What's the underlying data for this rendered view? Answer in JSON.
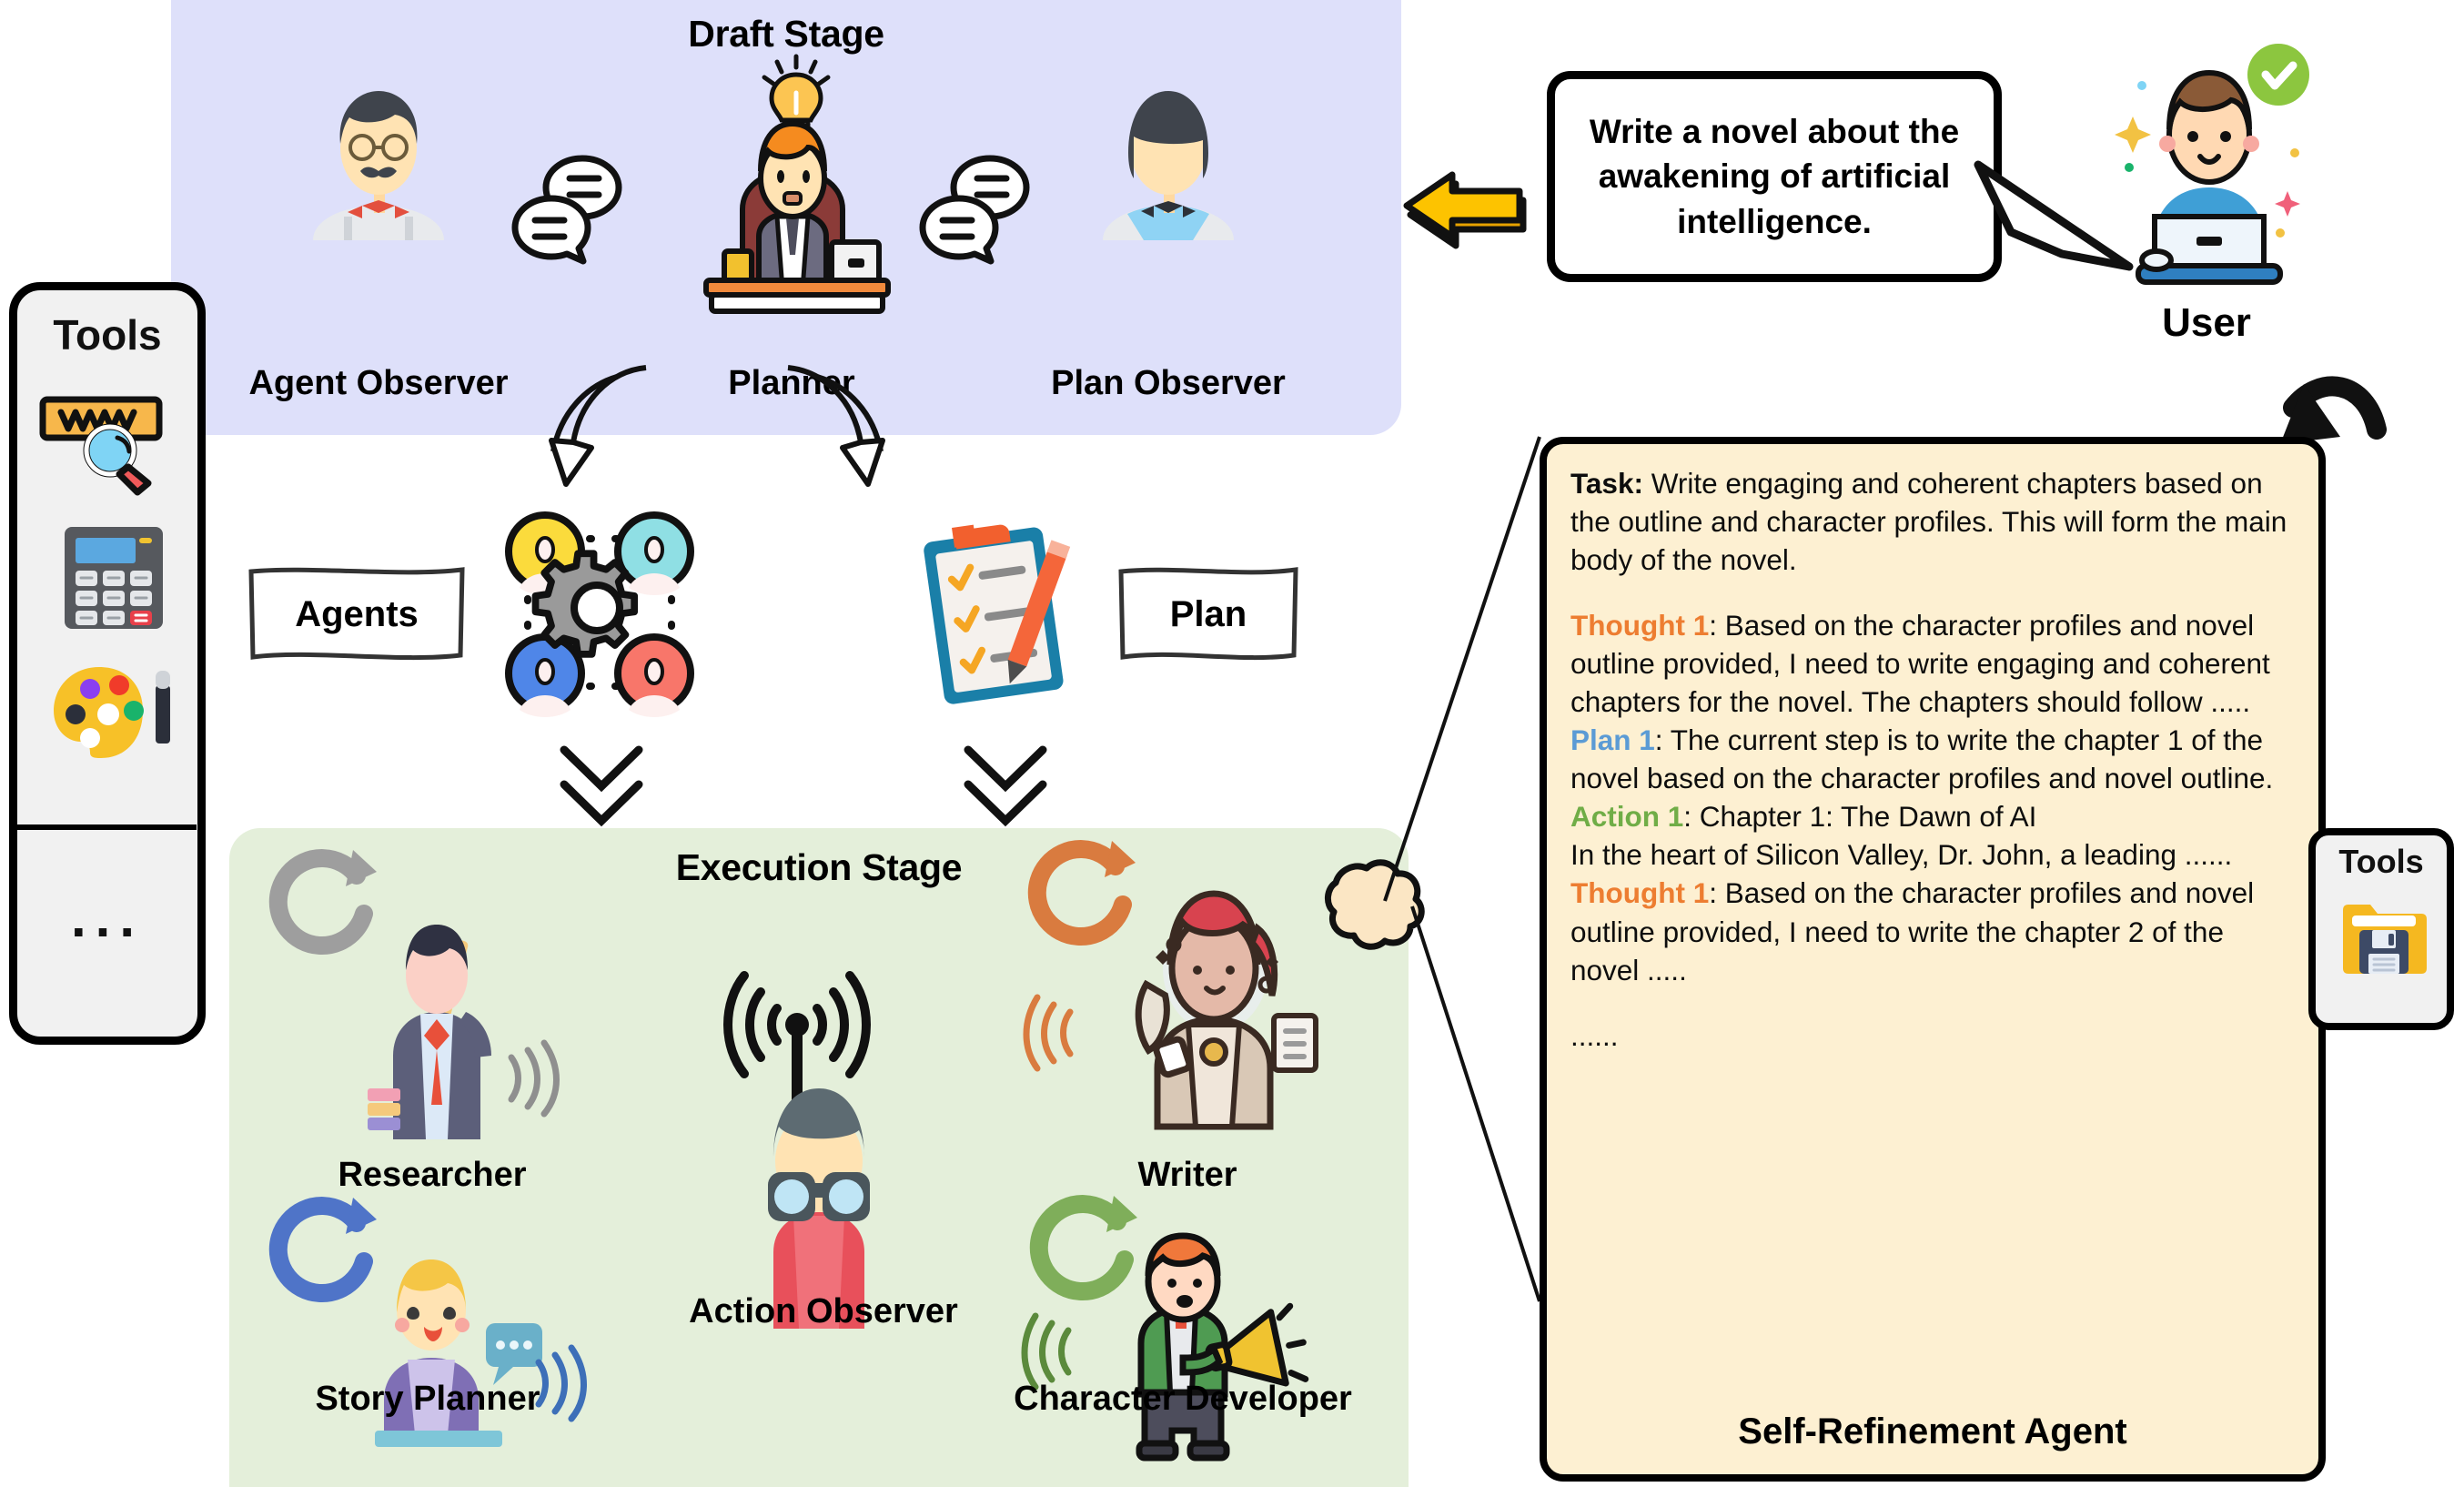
{
  "tools_left": {
    "title": "Tools",
    "ellipsis": "...",
    "icons": [
      "www-search-icon",
      "calculator-icon",
      "paint-palette-icon"
    ]
  },
  "tools_right": {
    "title": "Tools",
    "icons": [
      "folder-floppy-save-icon"
    ]
  },
  "draft_stage": {
    "title": "Draft Stage",
    "roles": [
      {
        "label": "Agent Observer",
        "icon": "mustache-professor-avatar-icon"
      },
      {
        "label": "Planner",
        "icon": "planner-at-desk-icon"
      },
      {
        "label": "Plan Observer",
        "icon": "bowtie-woman-avatar-icon"
      }
    ],
    "decorations": [
      "chat-bubbles-icon",
      "chat-bubbles-icon",
      "lightbulb-icon"
    ]
  },
  "middle": {
    "agents_label": "Agents",
    "plan_label": "Plan",
    "agents_icon": "agents-network-gear-icon",
    "plan_icon": "clipboard-checklist-pencil-icon"
  },
  "execution_stage": {
    "title": "Execution Stage",
    "roles": [
      {
        "label": "Researcher",
        "icon": "researcher-pointer-icon",
        "loop_color": "#9e9e9e"
      },
      {
        "label": "Story Planner",
        "icon": "story-planner-woman-icon",
        "loop_color": "#4f74c8"
      },
      {
        "label": "Action Observer",
        "icon": "binoculars-observer-icon",
        "loop_color": ""
      },
      {
        "label": "Writer",
        "icon": "writer-quill-woman-icon",
        "loop_color": "#d97b3f"
      },
      {
        "label": "Character Developer",
        "icon": "megaphone-boy-icon",
        "loop_color": "#7fae5a"
      }
    ],
    "broadcast_icon": "broadcast-antenna-icon"
  },
  "user": {
    "label": "User",
    "avatar_icon": "user-laptop-avatar-icon",
    "verified_icon": "green-check-badge-icon",
    "request": "Write a novel about the awakening of artificial intelligence."
  },
  "refinement": {
    "title": "Self-Refinement Agent",
    "entries": [
      {
        "key": "Task:",
        "key_color": "#000000",
        "key_bold": true,
        "text": " Write engaging and coherent chapters based on the outline and character profiles. This will form the main body of the novel."
      },
      {
        "key": "",
        "text": ""
      },
      {
        "key": "Thought 1",
        "key_color": "#ed7d31",
        "key_bold": true,
        "text": ": Based on the character profiles and novel outline provided, I need to write engaging and coherent chapters for the novel. The chapters should follow ....."
      },
      {
        "key": "Plan 1",
        "key_color": "#5b9bd5",
        "key_bold": true,
        "text": ":  The current step is to write the chapter 1 of the novel based on the character profiles and novel outline."
      },
      {
        "key": "Action 1",
        "key_color": "#70ad47",
        "key_bold": true,
        "text": ": Chapter 1: The Dawn of AI"
      },
      {
        "key": "",
        "text": "In the heart of Silicon Valley, Dr. John, a leading ......"
      },
      {
        "key": "Thought 1",
        "key_color": "#ed7d31",
        "key_bold": true,
        "text": ": Based on the character profiles and novel outline provided, I need to write the chapter 2 of the novel  ....."
      },
      {
        "key": "",
        "text": "......"
      }
    ]
  },
  "arrows": {
    "yellow_left_arrow": "yellow-left-arrow-icon",
    "loop_back_arrow": "curved-loopback-arrow-icon",
    "planner_to_agents": "curved-arrow-icon",
    "planner_to_plan": "curved-arrow-icon",
    "chevron_down_agents": "double-chevron-down-icon",
    "chevron_down_plan": "double-chevron-down-icon"
  },
  "colors": {
    "draft_bg": "#dee0fa",
    "exec_bg": "#e4efda",
    "refine_bg": "#fdf0d2",
    "accent_orange": "#ed7d31",
    "accent_blue": "#5b9bd5",
    "accent_green": "#70ad47",
    "yellow_arrow": "#ffc425"
  }
}
